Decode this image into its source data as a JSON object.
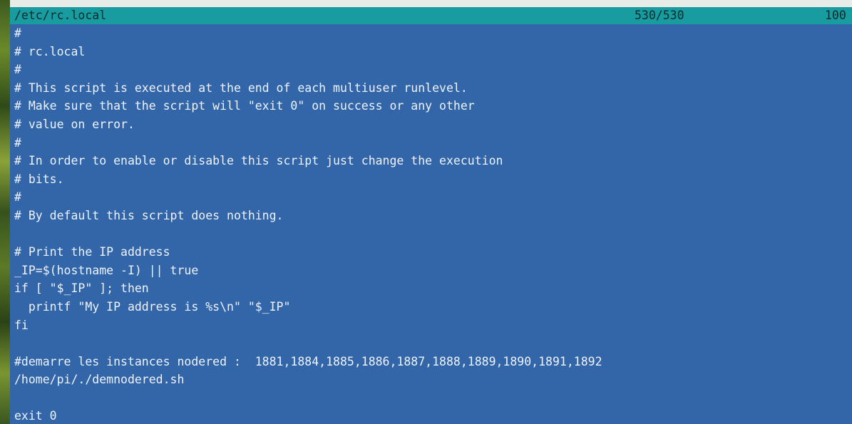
{
  "editor": {
    "filename": "/etc/rc.local",
    "position": "530/530",
    "percent": "100"
  },
  "lines": [
    "#",
    "# rc.local",
    "#",
    "# This script is executed at the end of each multiuser runlevel.",
    "# Make sure that the script will \"exit 0\" on success or any other",
    "# value on error.",
    "#",
    "# In order to enable or disable this script just change the execution",
    "# bits.",
    "#",
    "# By default this script does nothing.",
    "",
    "# Print the IP address",
    "_IP=$(hostname -I) || true",
    "if [ \"$_IP\" ]; then",
    "  printf \"My IP address is %s\\n\" \"$_IP\"",
    "fi",
    "",
    "#demarre les instances nodered :  1881,1884,1885,1886,1887,1888,1889,1890,1891,1892",
    "/home/pi/./demnodered.sh",
    "",
    "exit 0"
  ],
  "colors": {
    "background": "#3366a8",
    "titlebar": "#199ca0",
    "text": "#eef3ff"
  }
}
